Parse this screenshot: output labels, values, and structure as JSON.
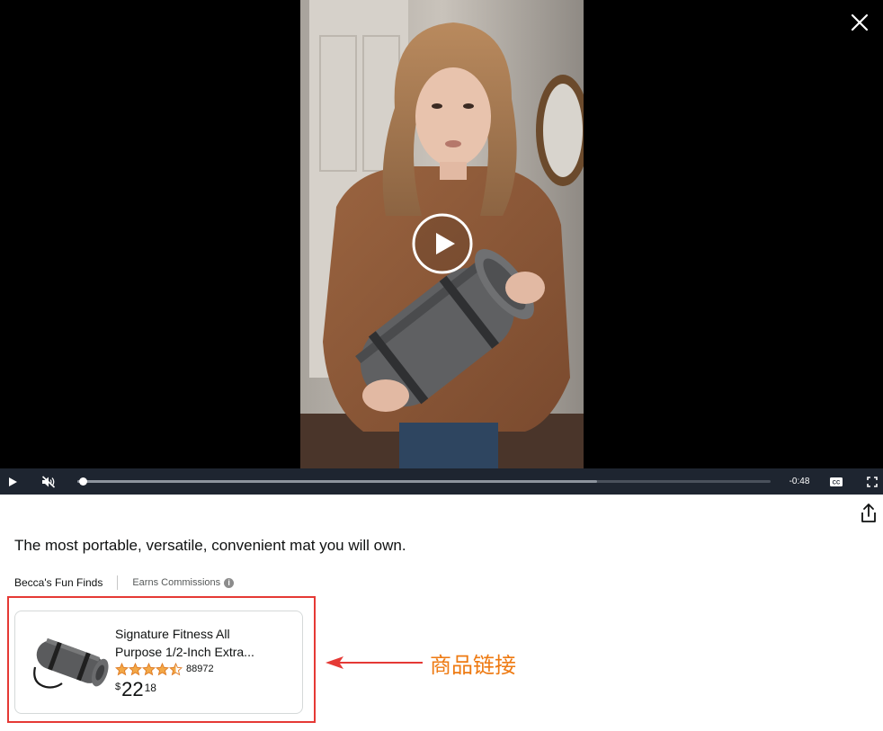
{
  "video": {
    "time_remaining": "-0:48",
    "progress_fraction": 0.003,
    "buffered_fraction": 0.75,
    "muted": true,
    "playing": false,
    "cc_label": "CC",
    "icons": {
      "close": "close-icon",
      "play_overlay": "play-circle-icon",
      "play": "play-icon",
      "mute": "muted-speaker-icon",
      "cc": "closed-captions-icon",
      "fullscreen": "fullscreen-icon",
      "share": "share-icon"
    }
  },
  "caption": "The most portable, versatile, convenient mat you will own.",
  "creator": {
    "name": "Becca's Fun Finds",
    "commission_label": "Earns Commissions",
    "info_icon": "i"
  },
  "product": {
    "title_line1": "Signature Fitness All",
    "title_line2": "Purpose 1/2-Inch Extra...",
    "rating": 4.5,
    "review_count": "88972",
    "price_symbol": "$",
    "price_whole": "22",
    "price_fraction": "18"
  },
  "annotation": {
    "label": "商品链接",
    "color": "#ee7a12",
    "box_color": "#e53935"
  }
}
